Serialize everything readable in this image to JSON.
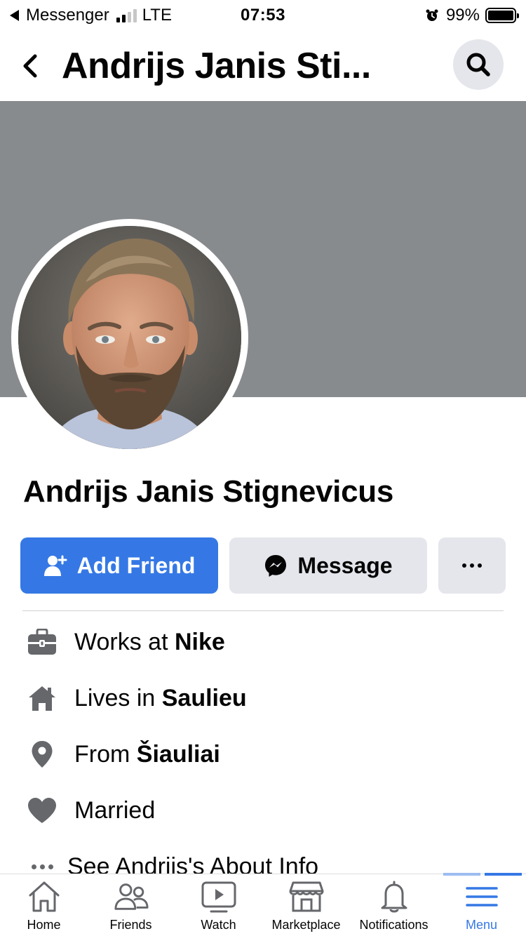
{
  "status_bar": {
    "back_app": "Messenger",
    "network": "LTE",
    "time": "07:53",
    "battery_pct": "99%",
    "battery_level": 0.99,
    "signal_bars": 2
  },
  "header": {
    "title": "Andrijs Janis Sti...",
    "back_icon": "chevron-left-icon",
    "search_icon": "search-icon"
  },
  "profile": {
    "name": "Andrijs Janis Stignevicus"
  },
  "actions": {
    "add_friend": "Add Friend",
    "message": "Message",
    "more_icon": "ellipsis-icon"
  },
  "intro": [
    {
      "icon": "briefcase-icon",
      "prefix": "Works at ",
      "value": "Nike"
    },
    {
      "icon": "home-icon",
      "prefix": "Lives in ",
      "value": "Saulieu"
    },
    {
      "icon": "location-pin-icon",
      "prefix": "From ",
      "value": "Šiauliai"
    },
    {
      "icon": "heart-icon",
      "prefix": "",
      "value": "Married"
    },
    {
      "icon": "ellipsis-icon",
      "prefix": "",
      "value": "See Andrijs's About Info"
    }
  ],
  "tabs": [
    {
      "label": "Home",
      "icon": "home-icon"
    },
    {
      "label": "Friends",
      "icon": "friends-icon"
    },
    {
      "label": "Watch",
      "icon": "watch-icon"
    },
    {
      "label": "Marketplace",
      "icon": "marketplace-icon"
    },
    {
      "label": "Notifications",
      "icon": "bell-icon"
    },
    {
      "label": "Menu",
      "icon": "menu-icon",
      "active": true
    }
  ],
  "colors": {
    "accent": "#3578e5",
    "cover": "#888b8e",
    "button_gray": "#e4e6eb",
    "icon_gray": "#65676b"
  }
}
